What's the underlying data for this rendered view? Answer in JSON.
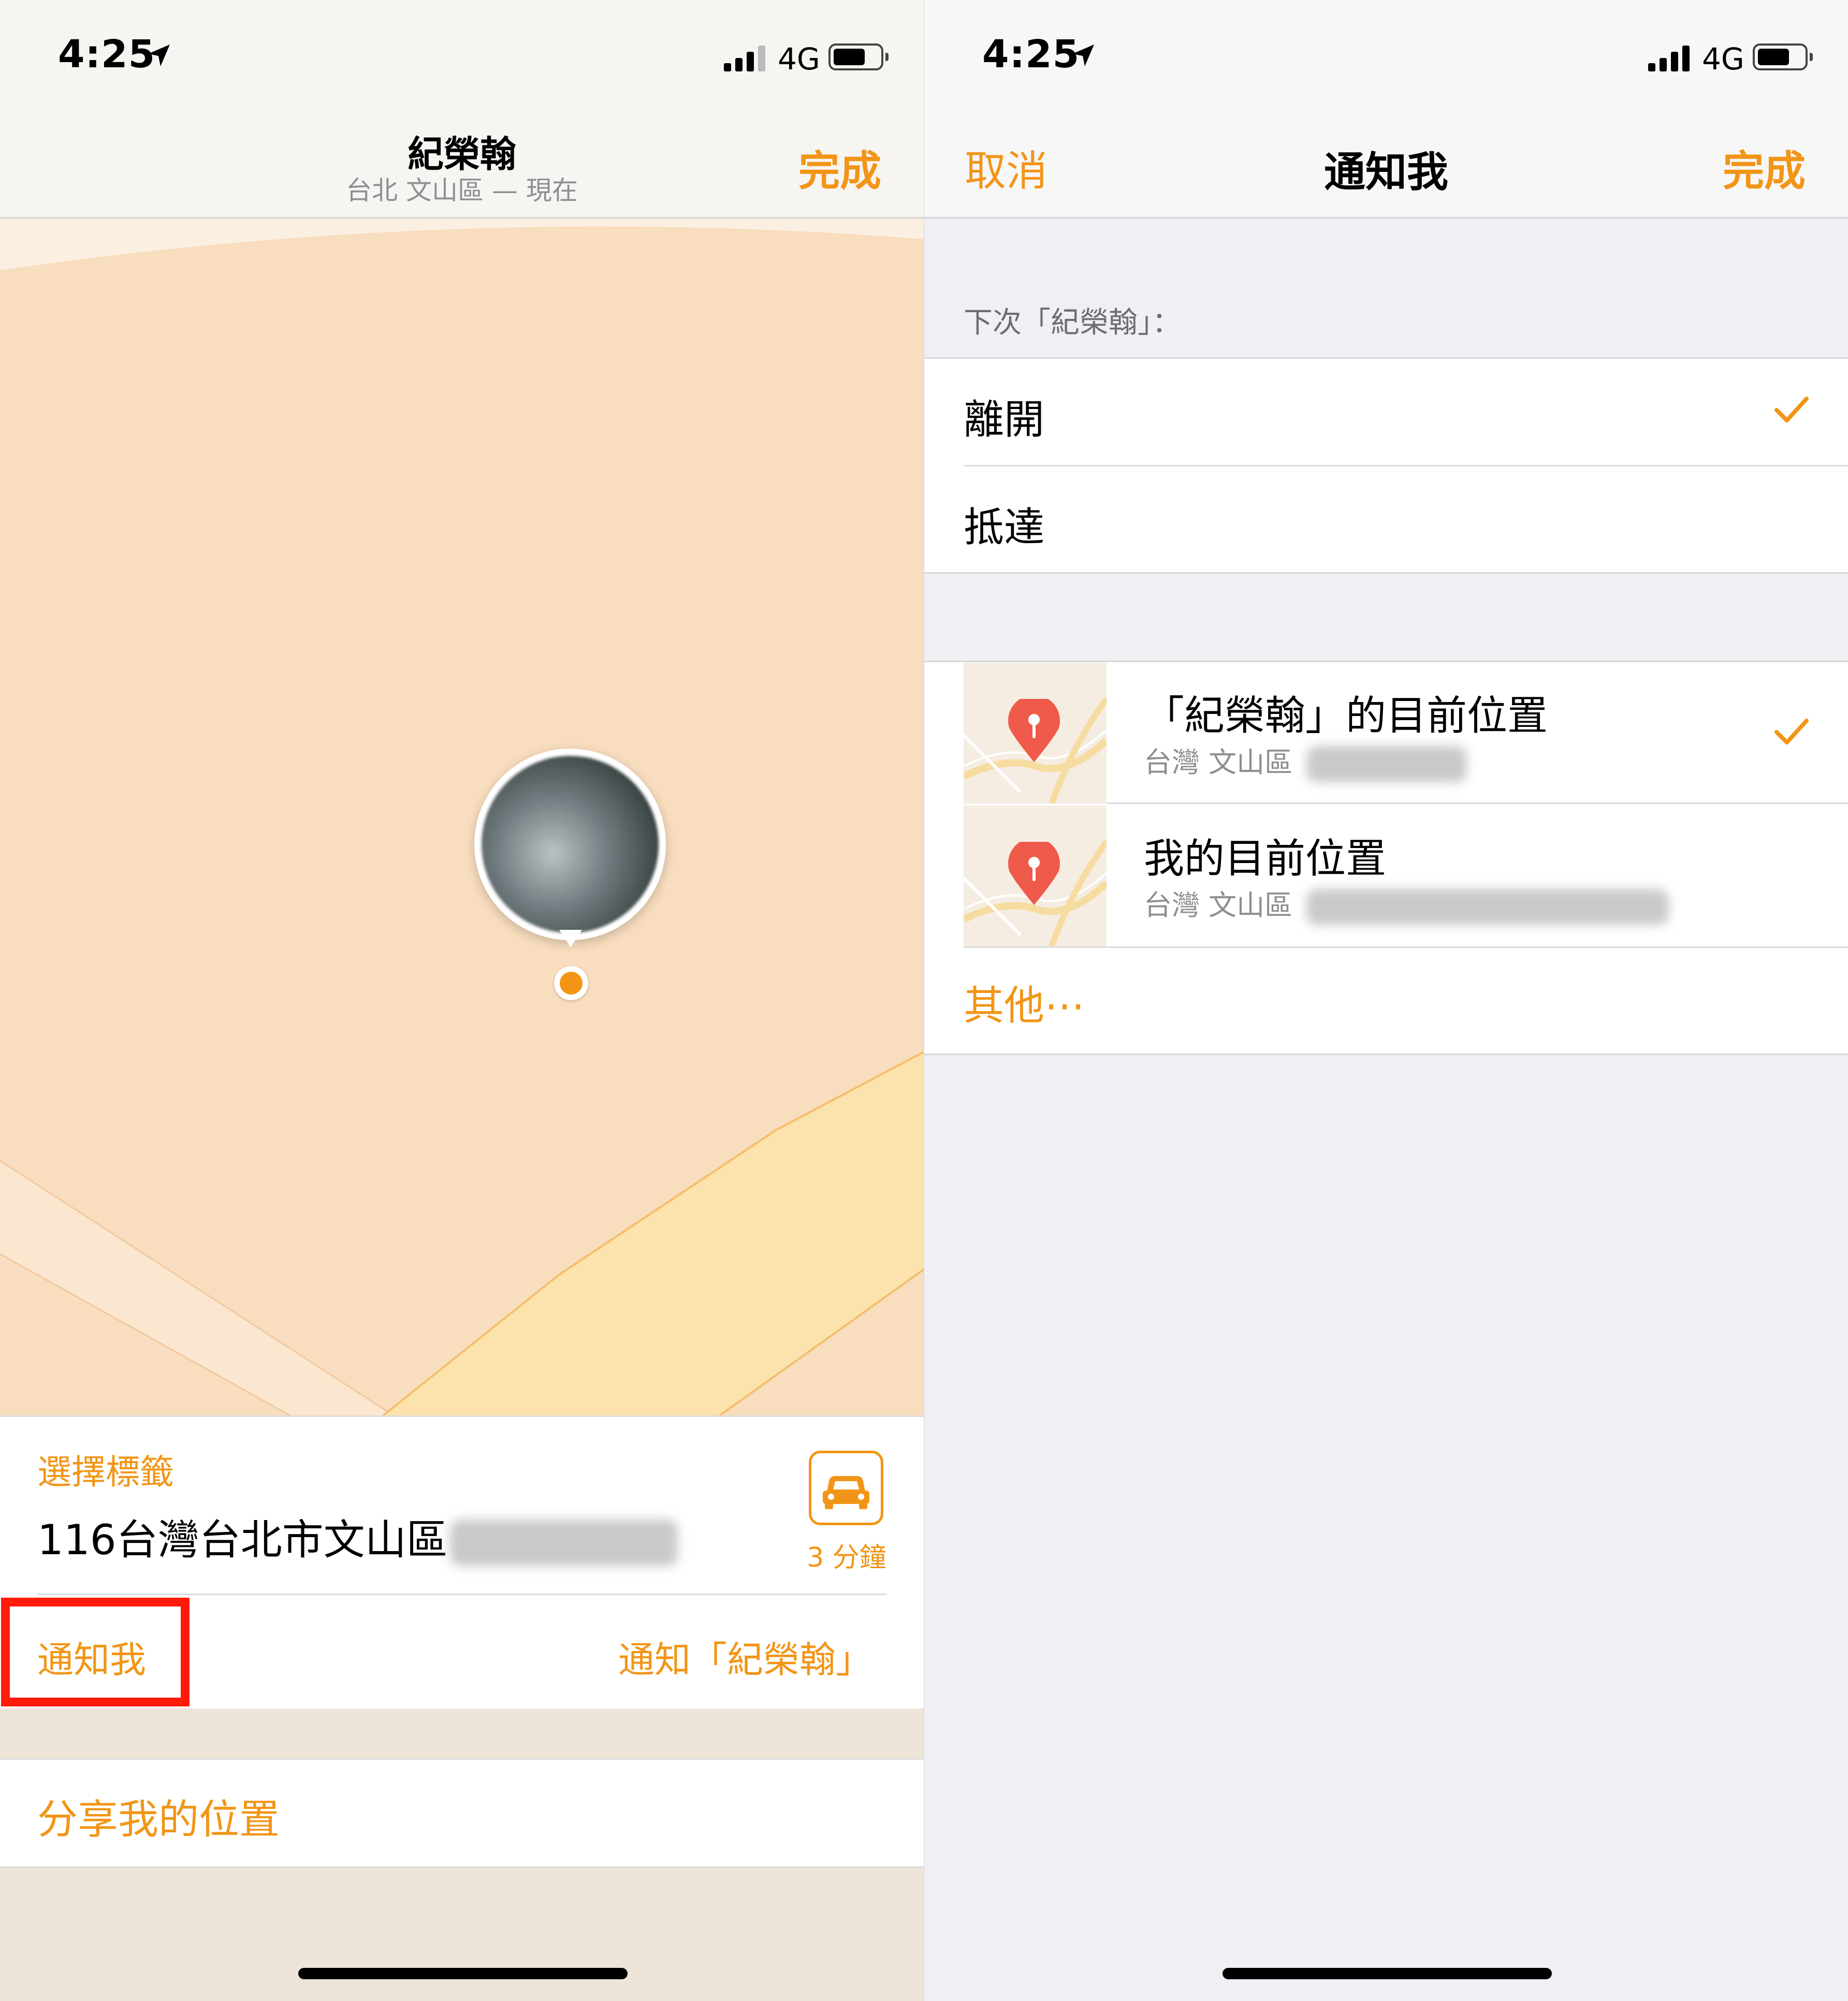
{
  "left_screen": {
    "status": {
      "time": "4:25",
      "network": "4G"
    },
    "nav": {
      "title": "紀榮翰",
      "subtitle": "台北 文山區 — 現在",
      "done_label": "完成"
    },
    "card": {
      "tag_label": "選擇標籤",
      "address": "116台灣台北市文山區",
      "eta": "3 分鐘",
      "notify_me_label": "通知我",
      "notify_other_label": "通知「紀榮翰」"
    },
    "share_label": "分享我的位置"
  },
  "right_screen": {
    "status": {
      "time": "4:25",
      "network": "4G"
    },
    "nav": {
      "cancel_label": "取消",
      "title": "通知我",
      "done_label": "完成"
    },
    "section_label": "下次「紀榮翰」：",
    "options": [
      {
        "label": "離開",
        "checked": true
      },
      {
        "label": "抵達",
        "checked": false
      }
    ],
    "locations": [
      {
        "title": "「紀榮翰」的目前位置",
        "subtitle": "台灣 文山區",
        "checked": true
      },
      {
        "title": "我的目前位置",
        "subtitle": "台灣 文山區",
        "checked": false
      }
    ],
    "other_label": "其他⋯"
  },
  "colors": {
    "accent": "#f29516",
    "highlight_box": "#ff1a0b",
    "pin_red": "#f05a4a"
  }
}
